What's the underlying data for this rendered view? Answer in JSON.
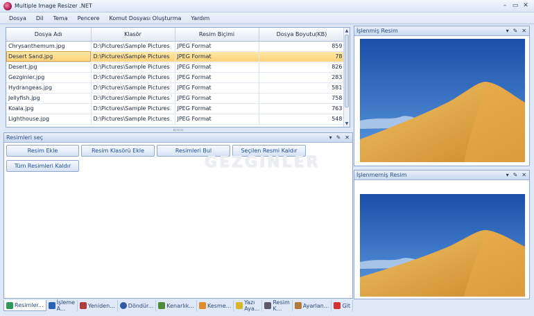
{
  "window": {
    "title": "Multiple Image Resizer .NET"
  },
  "menu": [
    "Dosya",
    "Dil",
    "Tema",
    "Pencere",
    "Komut Dosyası Oluşturma",
    "Yardım"
  ],
  "grid": {
    "columns": [
      "Dosya Adı",
      "Klasör",
      "Resim Biçimi",
      "Dosya Boyutu(KB)"
    ],
    "rows": [
      [
        "Chrysanthemum.jpg",
        "D:\\Pictures\\Sample Pictures",
        "JPEG Format",
        "859"
      ],
      [
        "Desert Sand.jpg",
        "D:\\Pictures\\Sample Pictures",
        "JPEG Format",
        "78"
      ],
      [
        "Desert.jpg",
        "D:\\Pictures\\Sample Pictures",
        "JPEG Format",
        "826"
      ],
      [
        "Gezginler.jpg",
        "D:\\Pictures\\Sample Pictures",
        "JPEG Format",
        "283"
      ],
      [
        "Hydrangeas.jpg",
        "D:\\Pictures\\Sample Pictures",
        "JPEG Format",
        "581"
      ],
      [
        "Jellyfish.jpg",
        "D:\\Pictures\\Sample Pictures",
        "JPEG Format",
        "758"
      ],
      [
        "Koala.jpg",
        "D:\\Pictures\\Sample Pictures",
        "JPEG Format",
        "763"
      ],
      [
        "Lighthouse.jpg",
        "D:\\Pictures\\Sample Pictures",
        "JPEG Format",
        "548"
      ]
    ],
    "selected_row": 1
  },
  "select_panel": {
    "title": "Resimleri seç",
    "buttons": [
      "Resim Ekle",
      "Resim Klasörü Ekle",
      "Resimleri Bul",
      "Seçilen Resmi Kaldır",
      "Tüm Resimleri Kaldır"
    ]
  },
  "processed_panel": {
    "title": "İşlenmiş Resim"
  },
  "unprocessed_panel": {
    "title": "İşlenmemiş Resim"
  },
  "tabs": [
    {
      "label": "Resimler...",
      "icon": "images-icon",
      "color": "#2f9a5a",
      "active": true
    },
    {
      "label": "İşleme A...",
      "icon": "checklist-icon",
      "color": "#2b63b6"
    },
    {
      "label": "Yeniden...",
      "icon": "resize-icon",
      "color": "#b23a3a"
    },
    {
      "label": "Döndür...",
      "icon": "rotate-icon",
      "color": "#3457a8"
    },
    {
      "label": "Kenarlık...",
      "icon": "border-icon",
      "color": "#4f8a3a"
    },
    {
      "label": "Kesme...",
      "icon": "crop-icon",
      "color": "#e08a2a"
    },
    {
      "label": "Yazı Aya...",
      "icon": "text-icon",
      "color": "#d9b52a"
    },
    {
      "label": "Resim K...",
      "icon": "image-settings-icon",
      "color": "#5a5a6a"
    },
    {
      "label": "Ayarlan...",
      "icon": "settings-icon",
      "color": "#b07a3a"
    },
    {
      "label": "Git",
      "icon": "go-icon",
      "color": "#d43030"
    }
  ],
  "watermark": "GEZGINLER",
  "colors": {
    "selected_row": "#fdd27a",
    "accent": "#2b4e86"
  }
}
